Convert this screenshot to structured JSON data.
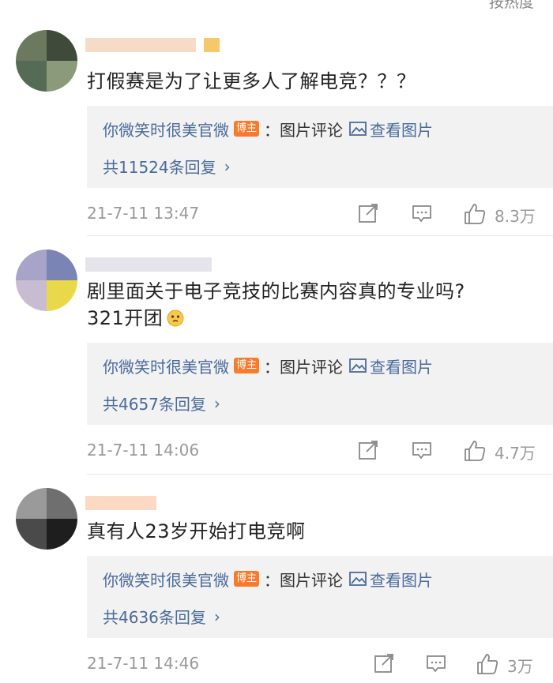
{
  "sort_label": "按热度",
  "comments": [
    {
      "text_line1": "打假赛是为了让更多人了解电竞？？？",
      "text_line2": "",
      "reply_author": "你微笑时很美官微",
      "badge": "博主",
      "reply_label": "：图片评论",
      "view_image": "查看图片",
      "reply_count": "共11524条回复",
      "date": "21-7-11 13:47",
      "likes": "8.3万"
    },
    {
      "text_line1": "剧里面关于电子竞技的比赛内容真的专业吗?",
      "text_line2": "321开团",
      "reply_author": "你微笑时很美官微",
      "badge": "博主",
      "reply_label": "：图片评论",
      "view_image": "查看图片",
      "reply_count": "共4657条回复",
      "date": "21-7-11 14:06",
      "likes": "4.7万"
    },
    {
      "text_line1": "真有人23岁开始打电竞啊",
      "text_line2": "",
      "reply_author": "你微笑时很美官微",
      "badge": "博主",
      "reply_label": "：图片评论",
      "view_image": "查看图片",
      "reply_count": "共4636条回复",
      "date": "21-7-11 14:46",
      "likes": "3万"
    }
  ],
  "icons": {
    "share": "share-icon",
    "comment": "comment-icon",
    "like": "thumbs-up-icon",
    "image": "image-icon",
    "chevron": "chevron-right-icon"
  },
  "colors": {
    "link_blue": "#4a6a9a",
    "badge_orange": "#f77b2b",
    "reply_bg": "#f2f2f2",
    "meta_gray": "#999999"
  }
}
